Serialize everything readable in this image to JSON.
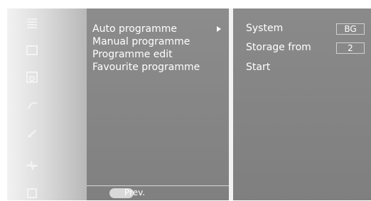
{
  "menu": {
    "items": [
      {
        "label": "Auto programme"
      },
      {
        "label": "Manual programme"
      },
      {
        "label": "Programme edit"
      },
      {
        "label": "Favourite programme"
      }
    ]
  },
  "footer": {
    "prev_label": "Prev."
  },
  "settings": {
    "system_label": "System",
    "system_value": "BG",
    "storage_label": "Storage from",
    "storage_value": "2",
    "start_label": "Start"
  },
  "icons": [
    "menu-grid-icon",
    "square-icon",
    "speaker-icon",
    "clock-icon",
    "satellite-icon",
    "plane-icon",
    "box-icon"
  ]
}
